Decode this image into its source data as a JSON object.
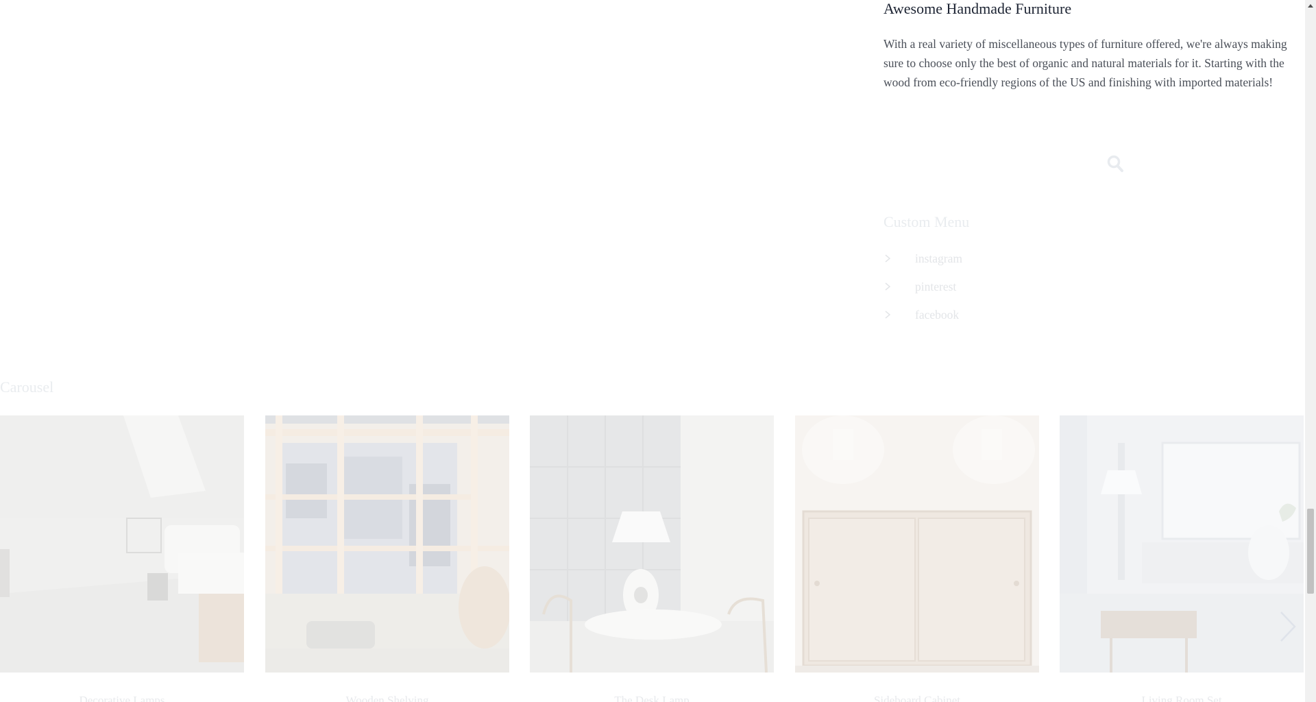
{
  "widget": {
    "title": "Awesome Handmade Furniture",
    "text": "With a real variety of miscellaneous types of furniture offered, we're always making sure to choose only the best of organic and natural materials for it. Starting with the wood from eco-friendly regions of the US and finishing with imported materials!"
  },
  "search": {
    "icon": "search-icon"
  },
  "custom_menu": {
    "title": "Custom Menu",
    "items": [
      {
        "label": "instagram",
        "icon": "chevron-right-icon"
      },
      {
        "label": "pinterest",
        "icon": "chevron-right-icon"
      },
      {
        "label": "facebook",
        "icon": "chevron-right-icon"
      }
    ]
  },
  "carousel": {
    "title": "Carousel",
    "next_icon": "chevron-right-icon",
    "slides": [
      {
        "caption": "Decorative Lamps"
      },
      {
        "caption": "Wooden Shelving"
      },
      {
        "caption": "The Desk Lamp"
      },
      {
        "caption": "Sideboard Cabinet"
      },
      {
        "caption": "Living Room Set"
      }
    ]
  },
  "colors": {
    "heading": "#1d2433",
    "body_text": "#4a4f58",
    "faded_text": "#e6e8eb"
  }
}
